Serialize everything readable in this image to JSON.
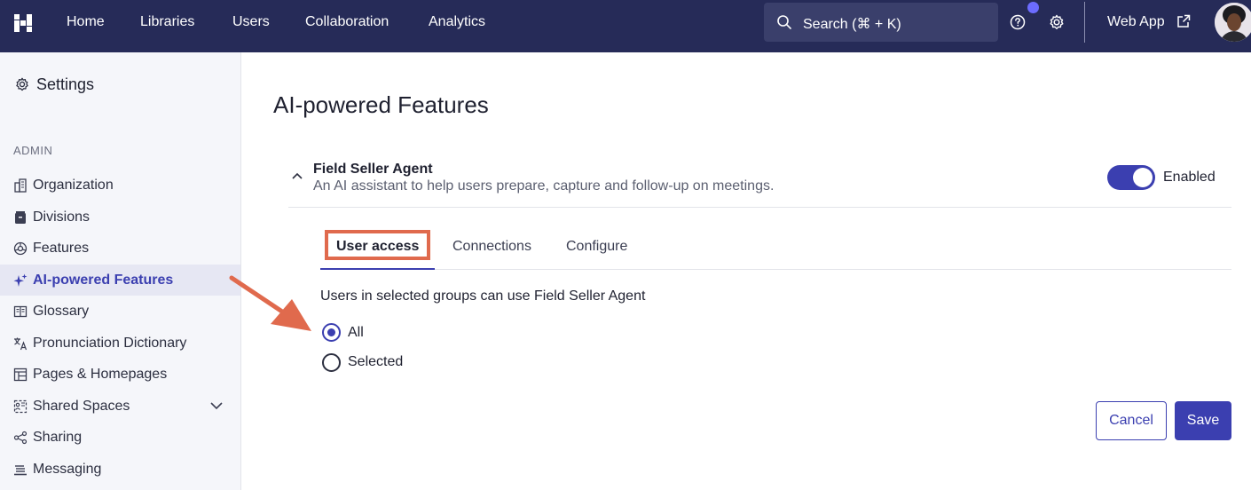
{
  "topbar": {
    "nav": [
      "Home",
      "Libraries",
      "Users",
      "Collaboration",
      "Analytics"
    ],
    "search_placeholder": "Search (⌘ + K)",
    "web_app_label": "Web App"
  },
  "sidebar": {
    "title": "Settings",
    "section": "ADMIN",
    "items": [
      {
        "label": "Organization",
        "icon": "building-icon"
      },
      {
        "label": "Divisions",
        "icon": "archive-icon"
      },
      {
        "label": "Features",
        "icon": "features-icon"
      },
      {
        "label": "AI-powered Features",
        "icon": "sparkle-icon",
        "active": true
      },
      {
        "label": "Glossary",
        "icon": "book-icon"
      },
      {
        "label": "Pronunciation Dictionary",
        "icon": "translate-icon"
      },
      {
        "label": "Pages & Homepages",
        "icon": "layout-icon"
      },
      {
        "label": "Shared Spaces",
        "icon": "spaces-icon"
      },
      {
        "label": "Sharing",
        "icon": "share-icon"
      },
      {
        "label": "Messaging",
        "icon": "messaging-icon"
      }
    ]
  },
  "main": {
    "title": "AI-powered Features",
    "feature": {
      "name": "Field Seller Agent",
      "description": "An AI assistant to help users prepare, capture and follow-up on meetings.",
      "toggle_label": "Enabled",
      "enabled": true
    },
    "tabs": [
      "User access",
      "Connections",
      "Configure"
    ],
    "access_text": "Users in selected groups can use Field Seller Agent",
    "radio_options": [
      {
        "label": "All",
        "checked": true
      },
      {
        "label": "Selected",
        "checked": false
      }
    ],
    "cancel_label": "Cancel",
    "save_label": "Save"
  },
  "colors": {
    "topbar": "#262b58",
    "accent": "#3b3fb0",
    "highlight": "#e06a4d"
  }
}
